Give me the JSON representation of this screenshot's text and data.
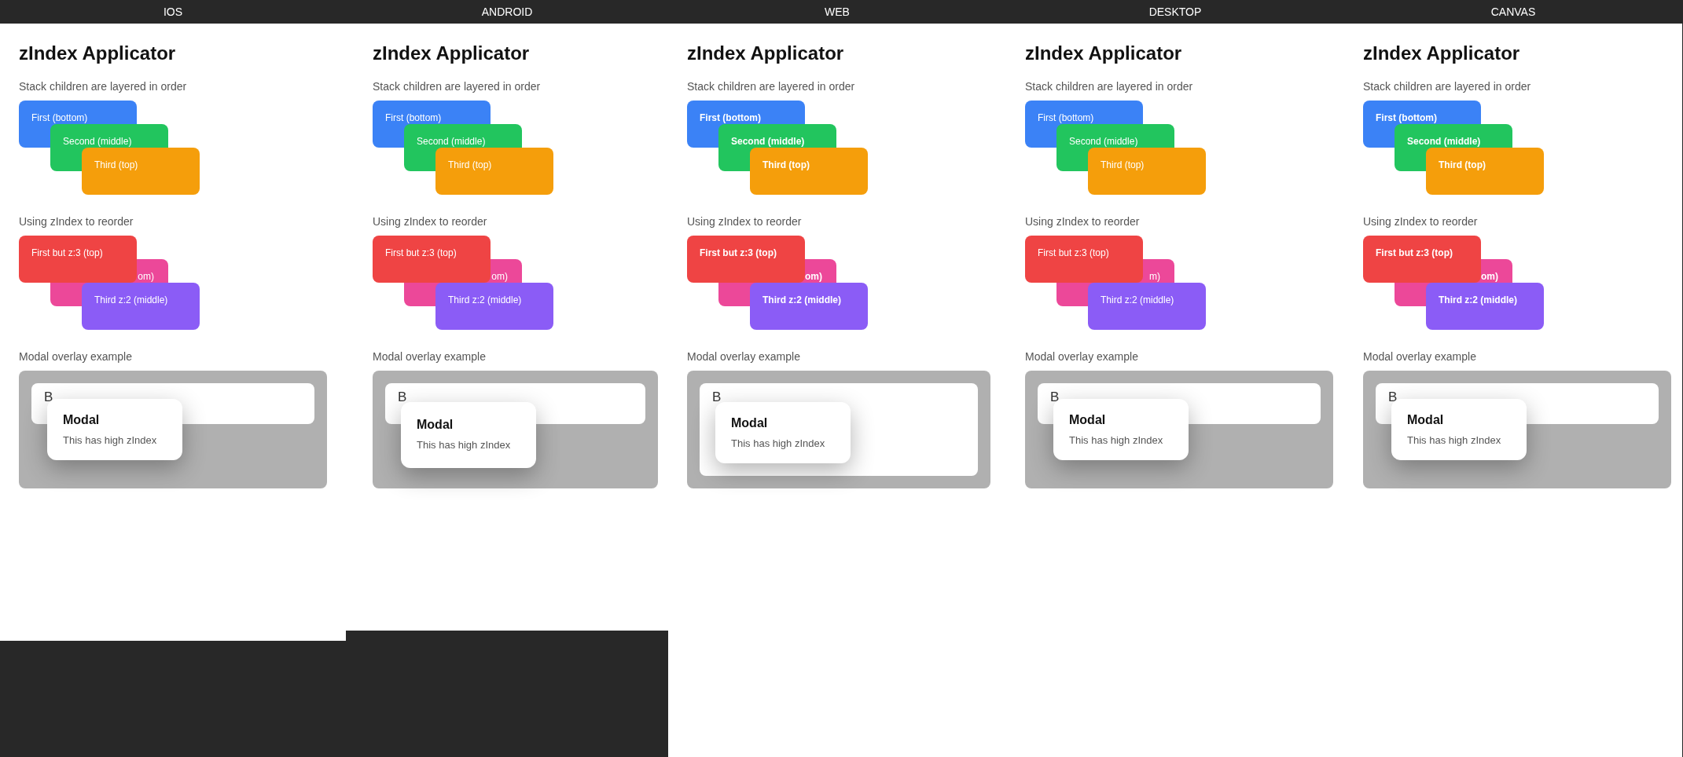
{
  "panels": [
    {
      "kind": "ios",
      "header": "IOS",
      "title": "zIndex Applicator",
      "sections": [
        {
          "kind": "stack",
          "caption": "Stack children are layered in order",
          "cards": [
            {
              "label": "First (bottom)",
              "color": "#3b82f6",
              "kind": "bottom"
            },
            {
              "label": "Second (middle)",
              "color": "#22c55e",
              "kind": "middle"
            },
            {
              "label": "Third (top)",
              "color": "#f59e0b",
              "kind": "top"
            }
          ]
        },
        {
          "kind": "stack",
          "caption": "Using zIndex to reorder",
          "cards": [
            {
              "label": "First but z:3 (top)",
              "color": "#ef4444",
              "kind": "top"
            },
            {
              "label": "om)",
              "color": "#ec4899",
              "kind": "bottom",
              "label_partly_hidden": true
            },
            {
              "label": "Third z:2 (middle)",
              "color": "#8b5cf6",
              "kind": "middle"
            }
          ]
        },
        {
          "kind": "modal",
          "caption": "Modal overlay example",
          "background_text": "B",
          "modal_title": "Modal",
          "modal_text": "This has high zIndex"
        }
      ]
    },
    {
      "kind": "android",
      "header": "ANDROID",
      "title": "zIndex Applicator",
      "sections": [
        {
          "kind": "stack",
          "caption": "Stack children are layered in order",
          "cards": [
            {
              "label": "First (bottom)",
              "color": "#3b82f6",
              "kind": "bottom"
            },
            {
              "label": "Second (middle)",
              "color": "#22c55e",
              "kind": "middle"
            },
            {
              "label": "Third (top)",
              "color": "#f59e0b",
              "kind": "top"
            }
          ]
        },
        {
          "kind": "stack",
          "caption": "Using zIndex to reorder",
          "cards": [
            {
              "label": "First but z:3 (top)",
              "color": "#ef4444",
              "kind": "top"
            },
            {
              "label": "om)",
              "color": "#ec4899",
              "kind": "bottom",
              "label_partly_hidden": true
            },
            {
              "label": "Third z:2 (middle)",
              "color": "#8b5cf6",
              "kind": "middle"
            }
          ]
        },
        {
          "kind": "modal",
          "caption": "Modal overlay example",
          "background_text": "B",
          "modal_title": "Modal",
          "modal_text": "This has high zIndex"
        }
      ]
    },
    {
      "kind": "web",
      "header": "WEB",
      "title": "zIndex Applicator",
      "sections": [
        {
          "kind": "stack",
          "caption": "Stack children are layered in order",
          "cards": [
            {
              "label": "First (bottom)",
              "color": "#3b82f6",
              "kind": "bottom"
            },
            {
              "label": "Second (middle)",
              "color": "#22c55e",
              "kind": "middle"
            },
            {
              "label": "Third (top)",
              "color": "#f59e0b",
              "kind": "top"
            }
          ]
        },
        {
          "kind": "stack",
          "caption": "Using zIndex to reorder",
          "cards": [
            {
              "label": "First but z:3 (top)",
              "color": "#ef4444",
              "kind": "top"
            },
            {
              "label": "om)",
              "color": "#ec4899",
              "kind": "bottom",
              "label_partly_hidden": true
            },
            {
              "label": "Third z:2 (middle)",
              "color": "#8b5cf6",
              "kind": "middle"
            }
          ]
        },
        {
          "kind": "modal",
          "caption": "Modal overlay example",
          "background_text": "B",
          "modal_title": "Modal",
          "modal_text": "This has high zIndex"
        }
      ]
    },
    {
      "kind": "desktop",
      "header": "DESKTOP",
      "title": "zIndex Applicator",
      "sections": [
        {
          "kind": "stack",
          "caption": "Stack children are layered in order",
          "cards": [
            {
              "label": "First (bottom)",
              "color": "#3b82f6",
              "kind": "bottom"
            },
            {
              "label": "Second (middle)",
              "color": "#22c55e",
              "kind": "middle"
            },
            {
              "label": "Third (top)",
              "color": "#f59e0b",
              "kind": "top"
            }
          ]
        },
        {
          "kind": "stack",
          "caption": "Using zIndex to reorder",
          "cards": [
            {
              "label": "First but z:3 (top)",
              "color": "#ef4444",
              "kind": "top"
            },
            {
              "label": "m)",
              "color": "#ec4899",
              "kind": "bottom",
              "label_partly_hidden": true
            },
            {
              "label": "Third z:2 (middle)",
              "color": "#8b5cf6",
              "kind": "middle"
            }
          ]
        },
        {
          "kind": "modal",
          "caption": "Modal overlay example",
          "background_text": "B",
          "modal_title": "Modal",
          "modal_text": "This has high zIndex"
        }
      ]
    },
    {
      "kind": "canvas",
      "header": "CANVAS",
      "title": "zIndex Applicator",
      "sections": [
        {
          "kind": "stack",
          "caption": "Stack children are layered in order",
          "cards": [
            {
              "label": "First (bottom)",
              "color": "#3b82f6",
              "kind": "bottom"
            },
            {
              "label": "Second (middle)",
              "color": "#22c55e",
              "kind": "middle"
            },
            {
              "label": "Third (top)",
              "color": "#f59e0b",
              "kind": "top"
            }
          ]
        },
        {
          "kind": "stack",
          "caption": "Using zIndex to reorder",
          "cards": [
            {
              "label": "First but z:3 (top)",
              "color": "#ef4444",
              "kind": "top"
            },
            {
              "label": "om)",
              "color": "#ec4899",
              "kind": "bottom",
              "label_partly_hidden": true
            },
            {
              "label": "Third z:2 (middle)",
              "color": "#8b5cf6",
              "kind": "middle"
            }
          ]
        },
        {
          "kind": "modal",
          "caption": "Modal overlay example",
          "background_text": "B",
          "modal_title": "Modal",
          "modal_text": "This has high zIndex"
        }
      ]
    }
  ]
}
